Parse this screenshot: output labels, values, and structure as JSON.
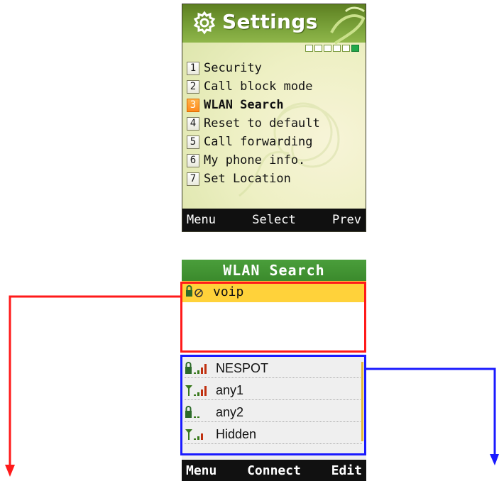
{
  "settings": {
    "title": "Settings",
    "page_indicator": {
      "total": 6,
      "current": 6
    },
    "items": [
      {
        "num": "1",
        "label": "Security"
      },
      {
        "num": "2",
        "label": "Call block mode"
      },
      {
        "num": "3",
        "label": "WLAN Search",
        "selected": true
      },
      {
        "num": "4",
        "label": "Reset to default"
      },
      {
        "num": "5",
        "label": "Call forwarding"
      },
      {
        "num": "6",
        "label": "My phone info."
      },
      {
        "num": "7",
        "label": "Set Location"
      }
    ],
    "softkeys": {
      "left": "Menu",
      "center": "Select",
      "right": "Prev"
    }
  },
  "wlan": {
    "title": "WLAN Search",
    "saved": [
      {
        "name": "voip",
        "icon": "lock-disconnected-icon"
      }
    ],
    "available": [
      {
        "name": "NESPOT",
        "icon": "lock-signal-icon"
      },
      {
        "name": "any1",
        "icon": "antenna-signal-icon"
      },
      {
        "name": "any2",
        "icon": "lock-weak-signal-icon"
      },
      {
        "name": "Hidden",
        "icon": "antenna-signal-icon"
      }
    ],
    "softkeys": {
      "left": "Menu",
      "center": "Connect",
      "right": "Edit"
    }
  },
  "colors": {
    "saved_highlight": "#ff1a1a",
    "available_highlight": "#1a1aff",
    "selected_row": "#ffd23a"
  }
}
